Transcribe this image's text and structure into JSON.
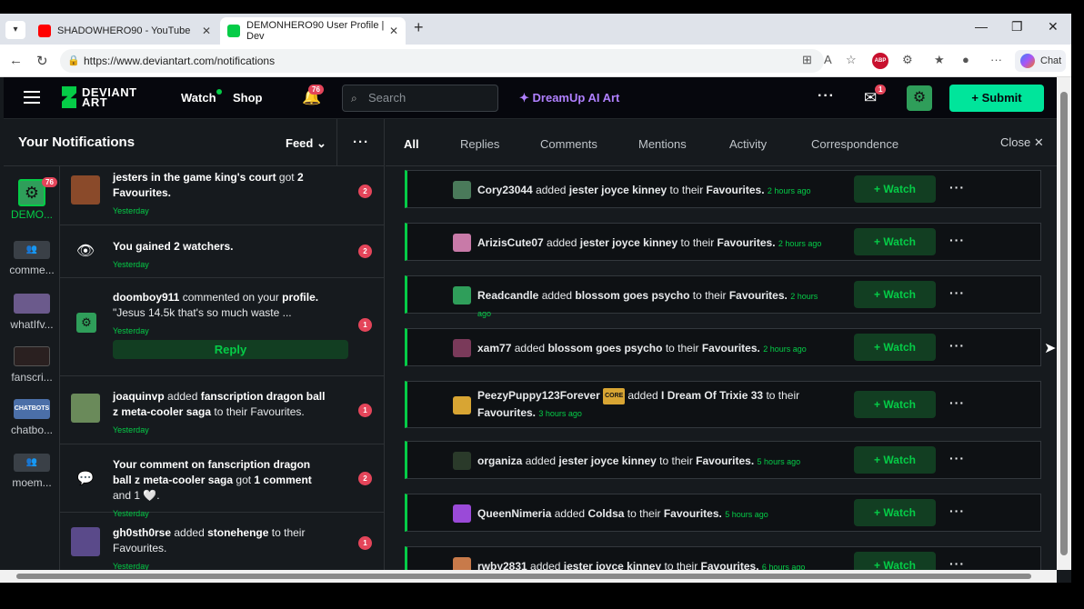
{
  "browser": {
    "tabs": [
      {
        "title": "SHADOWHERO90 - YouTube",
        "favicon_color": "#ff0000"
      },
      {
        "title": "DEMONHERO90 User Profile | Dev",
        "favicon_color": "#05cc47"
      }
    ],
    "close_glyph": "✕",
    "new_tab_glyph": "+",
    "url": "https://www.deviantart.com/notifications",
    "chat_label": "Chat",
    "abp_label": "ABP"
  },
  "topnav": {
    "logo_line1": "DEVIANT",
    "logo_line2": "ART",
    "watch": "Watch",
    "shop": "Shop",
    "bell_badge": "76",
    "search_placeholder": "Search",
    "dreamup": "DreamUp AI Art",
    "mail_badge": "1",
    "submit": "+ Submit"
  },
  "panel": {
    "title": "Your Notifications",
    "feed_label": "Feed",
    "folders": [
      {
        "label": "DEMO...",
        "badge": "76"
      },
      {
        "label": "comme...",
        "color": "#3a4047"
      },
      {
        "label": "whatIfv...",
        "color": "#6b5a8c"
      },
      {
        "label": "fanscri...",
        "color": "#2a2020"
      },
      {
        "label": "chatbo...",
        "color": "#4b6fa8"
      },
      {
        "label": "moem...",
        "color": "#3a4047"
      }
    ],
    "items": [
      {
        "title": "jesters in the game king's court",
        "action": "got",
        "detail": "2 Favourites.",
        "time": "Yesterday",
        "count": "2",
        "icon_color": "#8a4a2a"
      },
      {
        "title": "You gained 2 watchers.",
        "time": "Yesterday",
        "count": "2"
      },
      {
        "user": "doomboy911",
        "action": "commented on your",
        "target": "profile.",
        "quote": "\"Jesus 14.5k that's so much waste ...",
        "time": "Yesterday",
        "count": "1",
        "reply": "Reply"
      },
      {
        "user": "joaquinvp",
        "action": "added",
        "target": "fanscription dragon ball z meta-cooler saga",
        "suffix": "to their Favourites.",
        "time": "Yesterday",
        "count": "1",
        "icon_color": "#6a8a5a"
      },
      {
        "title": "Your comment on fanscription dragon ball z meta-cooler saga",
        "action": "got",
        "detail": "1 comment",
        "suffix": "and 1 🤍.",
        "time": "Yesterday",
        "count": "2"
      },
      {
        "user": "gh0sth0rse",
        "action": "added",
        "target": "stonehenge",
        "suffix": "to their Favourites.",
        "time": "Yesterday",
        "count": "1",
        "icon_color": "#5a4a8a"
      }
    ]
  },
  "filters": {
    "tabs": [
      "All",
      "Replies",
      "Comments",
      "Mentions",
      "Activity",
      "Correspondence"
    ],
    "active": "All",
    "close": "Close ✕"
  },
  "feed": [
    {
      "user": "Cory23044",
      "work": "jester joyce kinney",
      "time": "2 hours ago",
      "av": "#4a7a5a"
    },
    {
      "user": "ArizisCute07",
      "work": "jester joyce kinney",
      "time": "2 hours ago",
      "av": "#c87aa8"
    },
    {
      "user": "Readcandle",
      "work": "blossom goes psycho",
      "time": "2 hours ago",
      "av": "#2f9e5a"
    },
    {
      "user": "xam77",
      "work": "blossom goes psycho",
      "time": "2 hours ago",
      "av": "#7a3a5a"
    },
    {
      "user": "PeezyPuppy123Forever",
      "badge": "CORE",
      "work": "I Dream Of Trixie 33",
      "time": "3 hours ago",
      "av": "#d8a533"
    },
    {
      "user": "organiza",
      "work": "jester joyce kinney",
      "time": "5 hours ago",
      "av": "#2a3a2a"
    },
    {
      "user": "QueenNimeria",
      "work": "Coldsa",
      "time": "5 hours ago",
      "av": "#9a4ad8"
    },
    {
      "user": "rwby2831",
      "work": "jester joyce kinney",
      "time": "6 hours ago",
      "av": "#c87a4a"
    }
  ],
  "feed_common": {
    "added": "added",
    "to_their": "to their",
    "favourites": "Favourites.",
    "watch_btn": "+ Watch"
  }
}
